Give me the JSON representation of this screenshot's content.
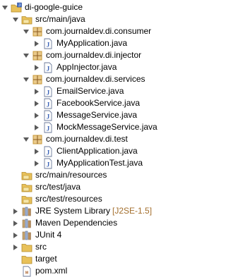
{
  "tree": {
    "items": [
      {
        "label": "di-google-guice",
        "decor": "",
        "icon": "project-icon",
        "expanded": true,
        "indent": 0
      },
      {
        "label": "src/main/java",
        "decor": "",
        "icon": "source-folder-icon",
        "expanded": true,
        "indent": 1
      },
      {
        "label": "com.journaldev.di.consumer",
        "decor": "",
        "icon": "package-icon",
        "expanded": true,
        "indent": 2
      },
      {
        "label": "MyApplication.java",
        "decor": "",
        "icon": "java-file-icon",
        "expanded": false,
        "indent": 3
      },
      {
        "label": "com.journaldev.di.injector",
        "decor": "",
        "icon": "package-icon",
        "expanded": true,
        "indent": 2
      },
      {
        "label": "AppInjector.java",
        "decor": "",
        "icon": "java-file-icon",
        "expanded": false,
        "indent": 3
      },
      {
        "label": "com.journaldev.di.services",
        "decor": "",
        "icon": "package-icon",
        "expanded": true,
        "indent": 2
      },
      {
        "label": "EmailService.java",
        "decor": "",
        "icon": "java-file-icon",
        "expanded": false,
        "indent": 3
      },
      {
        "label": "FacebookService.java",
        "decor": "",
        "icon": "java-file-icon",
        "expanded": false,
        "indent": 3
      },
      {
        "label": "MessageService.java",
        "decor": "",
        "icon": "java-file-icon",
        "expanded": false,
        "indent": 3
      },
      {
        "label": "MockMessageService.java",
        "decor": "",
        "icon": "java-file-icon",
        "expanded": false,
        "indent": 3
      },
      {
        "label": "com.journaldev.di.test",
        "decor": "",
        "icon": "package-icon",
        "expanded": true,
        "indent": 2
      },
      {
        "label": "ClientApplication.java",
        "decor": "",
        "icon": "java-file-icon",
        "expanded": false,
        "indent": 3
      },
      {
        "label": "MyApplicationTest.java",
        "decor": "",
        "icon": "java-file-icon",
        "expanded": false,
        "indent": 3
      },
      {
        "label": "src/main/resources",
        "decor": "",
        "icon": "source-folder-icon",
        "expanded": null,
        "indent": 1
      },
      {
        "label": "src/test/java",
        "decor": "",
        "icon": "source-folder-icon",
        "expanded": null,
        "indent": 1
      },
      {
        "label": "src/test/resources",
        "decor": "",
        "icon": "source-folder-icon",
        "expanded": null,
        "indent": 1
      },
      {
        "label": "JRE System Library",
        "decor": "[J2SE-1.5]",
        "icon": "library-icon",
        "expanded": false,
        "indent": 1
      },
      {
        "label": "Maven Dependencies",
        "decor": "",
        "icon": "library-icon",
        "expanded": false,
        "indent": 1
      },
      {
        "label": "JUnit 4",
        "decor": "",
        "icon": "library-icon",
        "expanded": false,
        "indent": 1
      },
      {
        "label": "src",
        "decor": "",
        "icon": "folder-icon",
        "expanded": false,
        "indent": 1
      },
      {
        "label": "target",
        "decor": "",
        "icon": "folder-icon",
        "expanded": null,
        "indent": 1
      },
      {
        "label": "pom.xml",
        "decor": "",
        "icon": "xml-file-icon",
        "expanded": null,
        "indent": 1
      }
    ]
  },
  "colors": {
    "folder": "#e8c15a",
    "folder_dark": "#b38a2a",
    "package": "#c89a3a",
    "java_file": "#3b63b8",
    "library": "#9a7b55",
    "decor": "#a36e2c"
  }
}
